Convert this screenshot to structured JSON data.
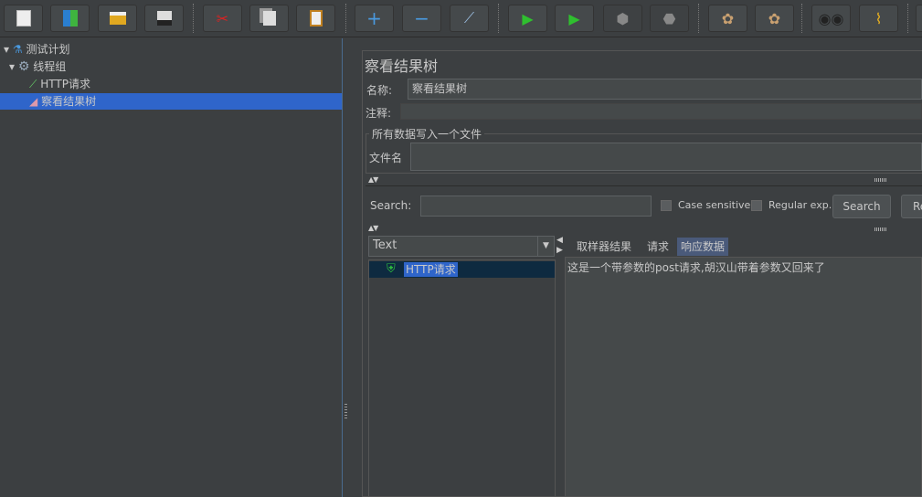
{
  "toolbar": {
    "buttons": [
      {
        "name": "new",
        "icon": "new-file-icon"
      },
      {
        "name": "templates",
        "icon": "templates-icon"
      },
      {
        "name": "open",
        "icon": "open-folder-icon"
      },
      {
        "name": "save",
        "icon": "save-icon"
      },
      {
        "name": "cut",
        "icon": "scissors-icon"
      },
      {
        "name": "copy",
        "icon": "copy-icon"
      },
      {
        "name": "paste",
        "icon": "paste-icon"
      },
      {
        "name": "expand",
        "icon": "plus-icon"
      },
      {
        "name": "collapse",
        "icon": "minus-icon"
      },
      {
        "name": "toggle",
        "icon": "toggle-icon"
      },
      {
        "name": "start",
        "icon": "play-icon"
      },
      {
        "name": "start-no-pauses",
        "icon": "play-no-timers-icon"
      },
      {
        "name": "stop",
        "icon": "stop-icon"
      },
      {
        "name": "shutdown",
        "icon": "shutdown-icon"
      },
      {
        "name": "clear",
        "icon": "clear-icon"
      },
      {
        "name": "clear-all",
        "icon": "clear-all-icon"
      },
      {
        "name": "search",
        "icon": "binoculars-icon"
      },
      {
        "name": "reset-search",
        "icon": "broom-icon"
      }
    ]
  },
  "tree": {
    "items": [
      {
        "label": "测试计划",
        "icon": "flask-icon"
      },
      {
        "label": "线程组",
        "icon": "gear-icon"
      },
      {
        "label": "HTTP请求",
        "icon": "pipette-icon"
      },
      {
        "label": "察看结果树",
        "icon": "chart-icon",
        "selected": true
      }
    ]
  },
  "panel": {
    "title": "察看结果树",
    "name_label": "名称:",
    "name_value": "察看结果树",
    "comment_label": "注释:",
    "comment_value": "",
    "file_group_title": "所有数据写入一个文件",
    "filename_label": "文件名",
    "filename_value": "",
    "search_label": "Search:",
    "search_value": "",
    "case_sensitive_label": "Case sensitive",
    "regex_label": "Regular exp.",
    "search_button": "Search",
    "reset_button": "Re",
    "renderer_select": "Text",
    "results": [
      {
        "label": "HTTP请求",
        "status": "success"
      }
    ],
    "tabs": [
      {
        "label": "取样器结果"
      },
      {
        "label": "请求"
      },
      {
        "label": "响应数据",
        "active": true
      }
    ],
    "response_text": "这是一个带参数的post请求,胡汉山带着参数又回来了"
  },
  "colors": {
    "selection": "#2f65ca",
    "background": "#3c3f41",
    "success": "#2fbf3f"
  }
}
